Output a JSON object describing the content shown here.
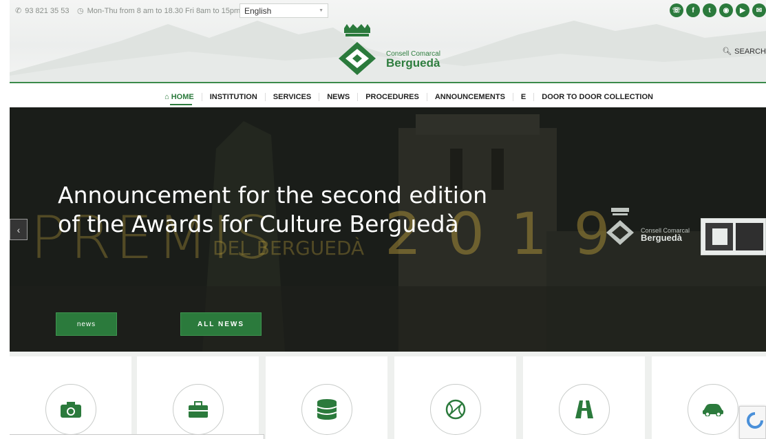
{
  "topbar": {
    "phone": "93 821 35 53",
    "hours": "Mon-Thu from 8 am to 18.30 Fri 8am to 15pm",
    "language": "English",
    "socials": [
      "whatsapp-icon",
      "facebook-icon",
      "twitter-icon",
      "instagram-icon",
      "youtube-icon",
      "email-icon"
    ]
  },
  "logo": {
    "line1": "Consell Comarcal",
    "line2": "Berguedà"
  },
  "search_label": "SEARCH",
  "nav": [
    "HOME",
    "INSTITUTION",
    "SERVICES",
    "NEWS",
    "PROCEDURES",
    "ANNOUNCEMENTS",
    "E",
    "DOOR TO DOOR COLLECTION"
  ],
  "hero": {
    "title_line1": "Announcement for the second edition",
    "title_line2": "of the Awards for Culture Berguedà",
    "bg_word": "PREMIS",
    "bg_year": "2019",
    "bg_sub": "DEL BERGUEDÀ",
    "logo_line1": "Consell Comarcal",
    "logo_line2": "Berguedà",
    "category_button": "news",
    "all_button": "ALL NEWS"
  },
  "cards": [
    {
      "icon": "camera-icon"
    },
    {
      "icon": "briefcase-icon"
    },
    {
      "icon": "database-icon"
    },
    {
      "icon": "basketball-icon"
    },
    {
      "icon": "road-icon"
    },
    {
      "icon": "car-icon"
    }
  ],
  "colors": {
    "brand_green": "#2b7a3c",
    "hero_bg": "#1b1e1a"
  }
}
